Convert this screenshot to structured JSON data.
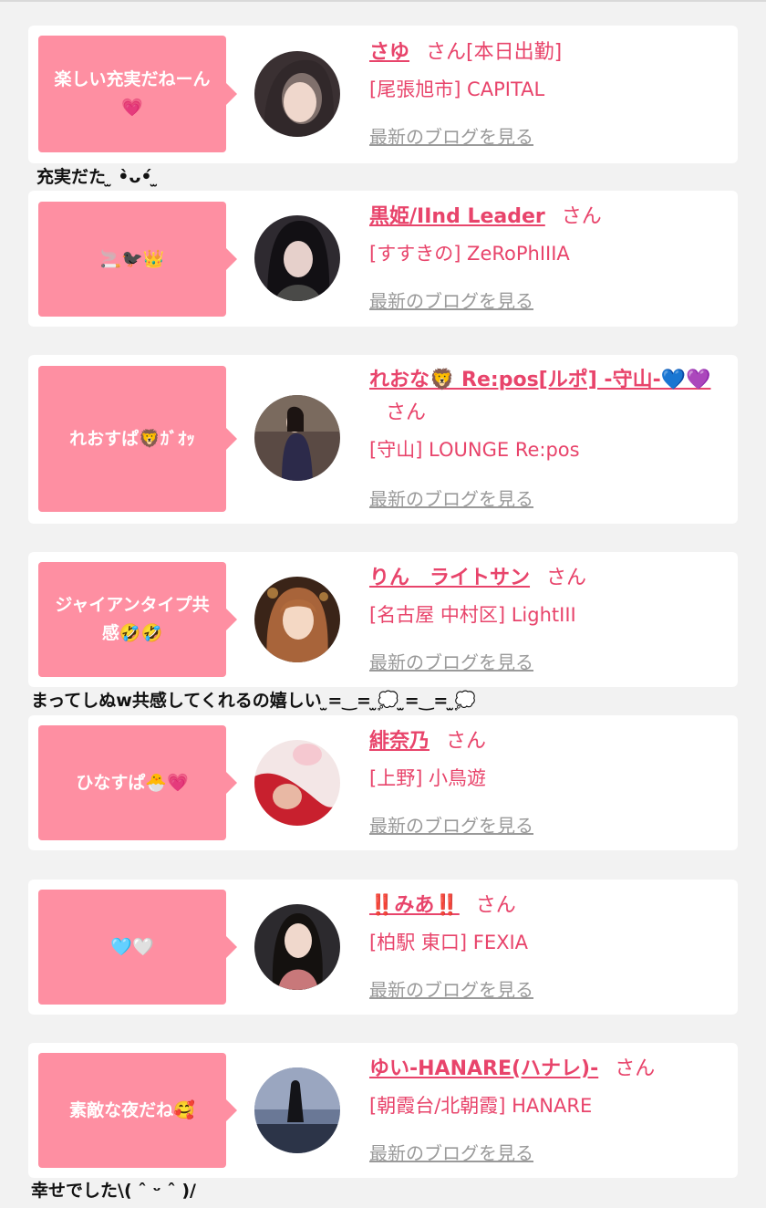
{
  "blog_link_label": "最新のブログを見る",
  "honorific": "さん",
  "entries": [
    {
      "bubble": "楽しい充実だねーん💗",
      "name": "さゆ",
      "honorific": "さん[本日出勤]",
      "shop": "[尾張旭市] CAPITAL",
      "comment_after": "充実だた ̫ •̀ᴗ•́ ̫"
    },
    {
      "bubble": "🚬🐦‍⬛👑",
      "name": "黒姫/IInd Leader",
      "honorific": "さん",
      "shop": "[すすきの] ZeRoPhIIIA",
      "comment_after": ""
    },
    {
      "bubble": "れおすぱ🦁ｶﾞｵｯ",
      "name": "れおな🦁 Re:pos[ルポ] -守山-💙💜",
      "honorific": "さん",
      "shop": "[守山] LOUNGE Re:pos",
      "comment_after": ""
    },
    {
      "bubble": "ジャイアンタイプ共感🤣🤣",
      "name": "りん　ライトサン",
      "honorific": "さん",
      "shop": "[名古屋 中村区] LightIII",
      "comment_after": "まってしぬw共感してくれるの嬉しい ̫=‿= ̫💭 ̫=‿= ̫💭"
    },
    {
      "bubble": "ひなすぱ🐣💗",
      "name": "緋奈乃",
      "honorific": "さん",
      "shop": "[上野] 小鳥遊",
      "comment_after": ""
    },
    {
      "bubble": "🩵🤍",
      "name": "‼️みあ‼️",
      "honorific": "さん",
      "shop": "[柏駅 東口] FEXIA",
      "comment_after": ""
    },
    {
      "bubble": "素敵な夜だね🥰",
      "name": "ゆい-HANARE(ハナレ)-",
      "honorific": "さん",
      "shop": "[朝霞台/北朝霞] HANARE",
      "comment_after": "幸せでした\\( ˆ ᵕ ˆ )/"
    }
  ],
  "colors": {
    "page_background": "#f2f2f2",
    "card_background": "#ffffff",
    "bubble_pink": "#fe8fa2",
    "name_pink": "#e8446b",
    "blog_link_gray": "#9a9a9a"
  }
}
